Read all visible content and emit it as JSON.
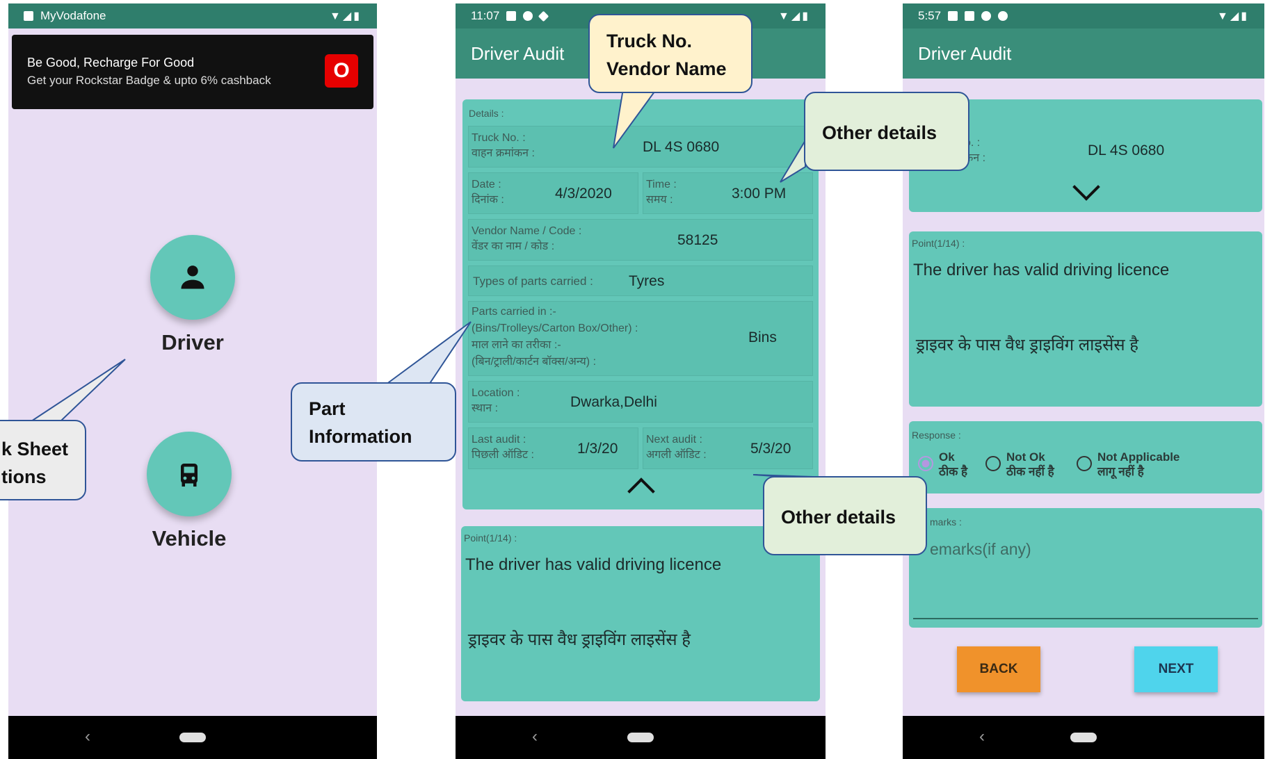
{
  "phone1": {
    "status_app": "MyVodafone",
    "status_icons": "▼◢▮",
    "notification": {
      "title": "Be Good, Recharge For Good",
      "subtitle": "Get your Rockstar Badge & upto 6% cashback",
      "logo_glyph": "O"
    },
    "driver_label": "Driver",
    "vehicle_label": "Vehicle"
  },
  "phone2": {
    "time": "11:07",
    "status_icons": "▼◢▮",
    "title": "Driver Audit",
    "details_header": "Details :",
    "truck_label_en": "Truck No. :",
    "truck_label_hi": "वाहन क्रमांकन :",
    "truck_value": "DL 4S 0680",
    "date_label_en": "Date :",
    "date_label_hi": "दिनांक :",
    "date_value": "4/3/2020",
    "time_label_en": "Time :",
    "time_label_hi": "समय :",
    "time_value": "3:00 PM",
    "vendor_label_en": "Vendor Name / Code :",
    "vendor_label_hi": "वेंडर का नाम / कोड :",
    "vendor_value": "58125",
    "parts_type_label": "Types of parts carried :",
    "parts_type_value": "Tyres",
    "parts_in_label_1": "Parts carried in :-",
    "parts_in_label_2": "(Bins/Trolleys/Carton Box/Other) :",
    "parts_in_label_3": "माल लाने का तरीका :-",
    "parts_in_label_4": "(बिन/ट्राली/कार्टन बॉक्स/अन्य) :",
    "parts_in_value": "Bins",
    "location_label_en": "Location :",
    "location_label_hi": "स्थान :",
    "location_value": "Dwarka,Delhi",
    "last_audit_label_en": "Last audit :",
    "last_audit_label_hi": "पिछली ऑडिट :",
    "last_audit_value": "1/3/20",
    "next_audit_label_en": "Next audit :",
    "next_audit_label_hi": "अगली ऑडिट :",
    "next_audit_value": "5/3/20",
    "point_header": "Point(1/14) :",
    "point_text_en": "The driver has valid driving licence",
    "point_text_hi": "ड्राइवर के पास वैध ड्राइविंग लाइसेंस है"
  },
  "phone3": {
    "time": "5:57",
    "status_icons": "▼◢▮",
    "title": "Driver Audit",
    "truck_label_en": "o. :",
    "truck_label_hi": "कन :",
    "truck_value": "DL 4S 0680",
    "point_header": "Point(1/14) :",
    "point_text_en": "The driver has valid driving licence",
    "point_text_hi": "ड्राइवर के पास वैध ड्राइविंग लाइसेंस है",
    "response_header": "Response :",
    "options": [
      {
        "en": "Ok",
        "hi": "ठीक है",
        "selected": true
      },
      {
        "en": "Not Ok",
        "hi": "ठीक नहीं है",
        "selected": false
      },
      {
        "en": "Not Applicable",
        "hi": "लागू नहीं है",
        "selected": false
      }
    ],
    "remarks_header": "marks :",
    "remarks_placeholder": "emarks(if any)",
    "back_label": "BACK",
    "next_label": "NEXT"
  },
  "callouts": {
    "checksheet_line1": "k Sheet",
    "checksheet_line2": "tions",
    "part_info_line1": "Part",
    "part_info_line2": "Information",
    "truck_vendor_line1": "Truck No.",
    "truck_vendor_line2": "Vendor Name",
    "other_details_top": "Other details",
    "other_details_bottom": "Other details"
  },
  "colors": {
    "teal_card": "#63c7b8",
    "app_bar": "#3a8e7a",
    "background": "#e8ddf3",
    "back_button": "#f0922b",
    "next_button": "#4fd4ec"
  }
}
